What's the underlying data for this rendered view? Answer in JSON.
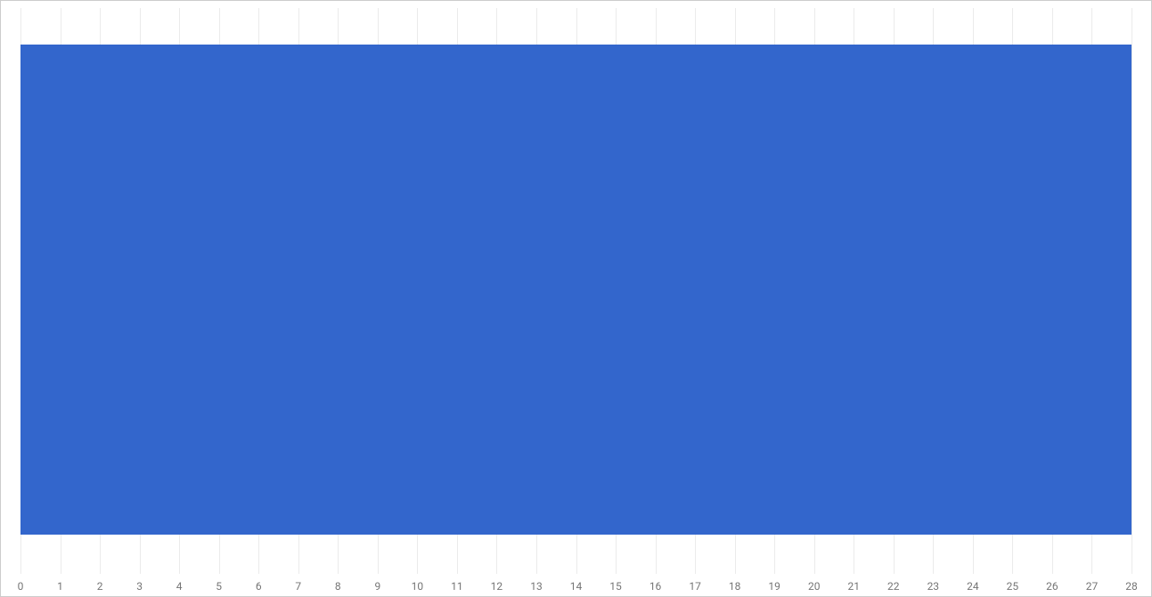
{
  "chart_data": {
    "type": "bar",
    "orientation": "horizontal",
    "x_ticks": [
      0,
      1,
      2,
      3,
      4,
      5,
      6,
      7,
      8,
      9,
      10,
      11,
      12,
      13,
      14,
      15,
      16,
      17,
      18,
      19,
      20,
      21,
      22,
      23,
      24,
      25,
      26,
      27,
      28
    ],
    "xlim": [
      0,
      28
    ],
    "categories": [
      ""
    ],
    "values": [
      28
    ],
    "color": "#3366cc",
    "bar_fraction_of_height": 0.865,
    "bar_top_fraction": 0.065
  }
}
